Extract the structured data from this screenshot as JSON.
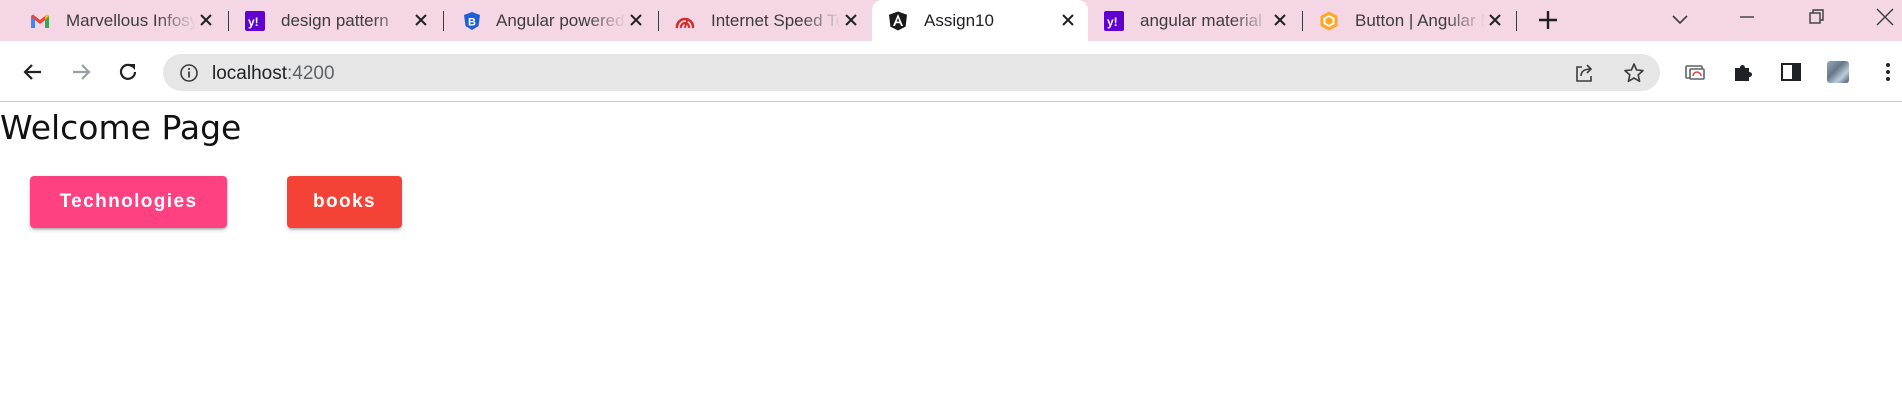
{
  "browser": {
    "tabs": [
      {
        "title": "Marvellous Infosystems",
        "icon": "gmail-icon"
      },
      {
        "title": "design pattern",
        "icon": "yahoo-icon"
      },
      {
        "title": "Angular powered Bootstrap",
        "icon": "bootstrap-icon"
      },
      {
        "title": "Internet Speed Test",
        "icon": "speedtest-icon"
      },
      {
        "title": "Assign10",
        "icon": "angular-icon",
        "active": true
      },
      {
        "title": "angular material",
        "icon": "yahoo-icon"
      },
      {
        "title": "Button | Angular Material",
        "icon": "angular-material-icon"
      }
    ],
    "address": {
      "host": "localhost",
      "port": ":4200"
    }
  },
  "page": {
    "title": "Welcome Page",
    "buttons": {
      "technologies": "Technologies",
      "books": "books"
    }
  },
  "colors": {
    "tabstrip": "#f4d6e4",
    "technologies_button": "#ff4081",
    "books_button": "#f44336"
  }
}
